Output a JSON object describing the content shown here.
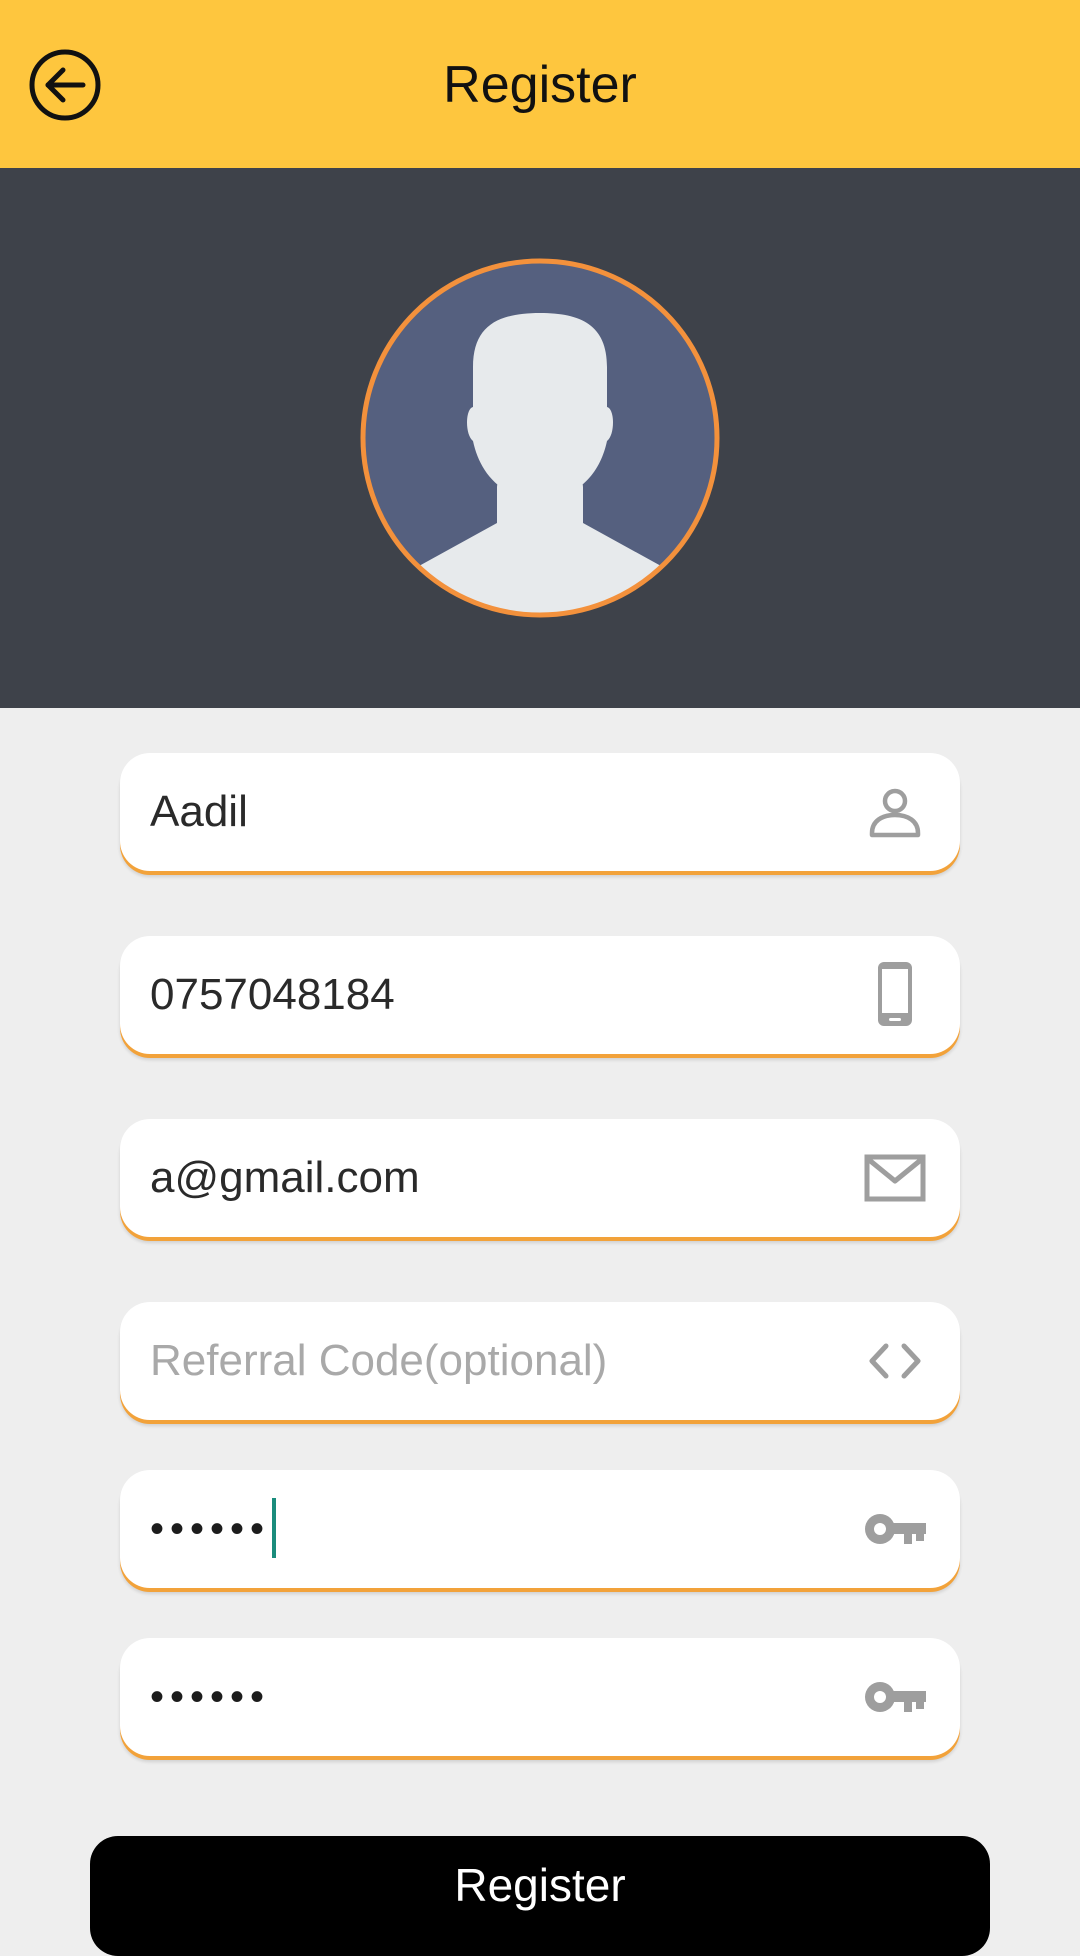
{
  "app_bar": {
    "title": "Register",
    "back_icon": "arrow-left-circle-icon",
    "background": "#fec63e"
  },
  "avatar": {
    "icon": "user-silhouette-icon",
    "ring_color": "#f3913c",
    "fill_color": "#55607f"
  },
  "form": {
    "name": {
      "value": "Aadil",
      "icon": "person-icon"
    },
    "phone": {
      "value": "0757048184",
      "icon": "phone-icon"
    },
    "email": {
      "value": "a@gmail.com",
      "icon": "mail-icon"
    },
    "referral": {
      "placeholder": "Referral Code(optional)",
      "value": "",
      "icon": "code-icon"
    },
    "password": {
      "value": "••••••",
      "icon": "key-icon",
      "focused": true
    },
    "confirm_password": {
      "value": "••••••",
      "icon": "key-icon"
    }
  },
  "register_button": {
    "label": "Register"
  },
  "colors": {
    "accent": "#f2a23a",
    "dark_panel": "#3e424a",
    "caret": "#1a8c7c"
  }
}
